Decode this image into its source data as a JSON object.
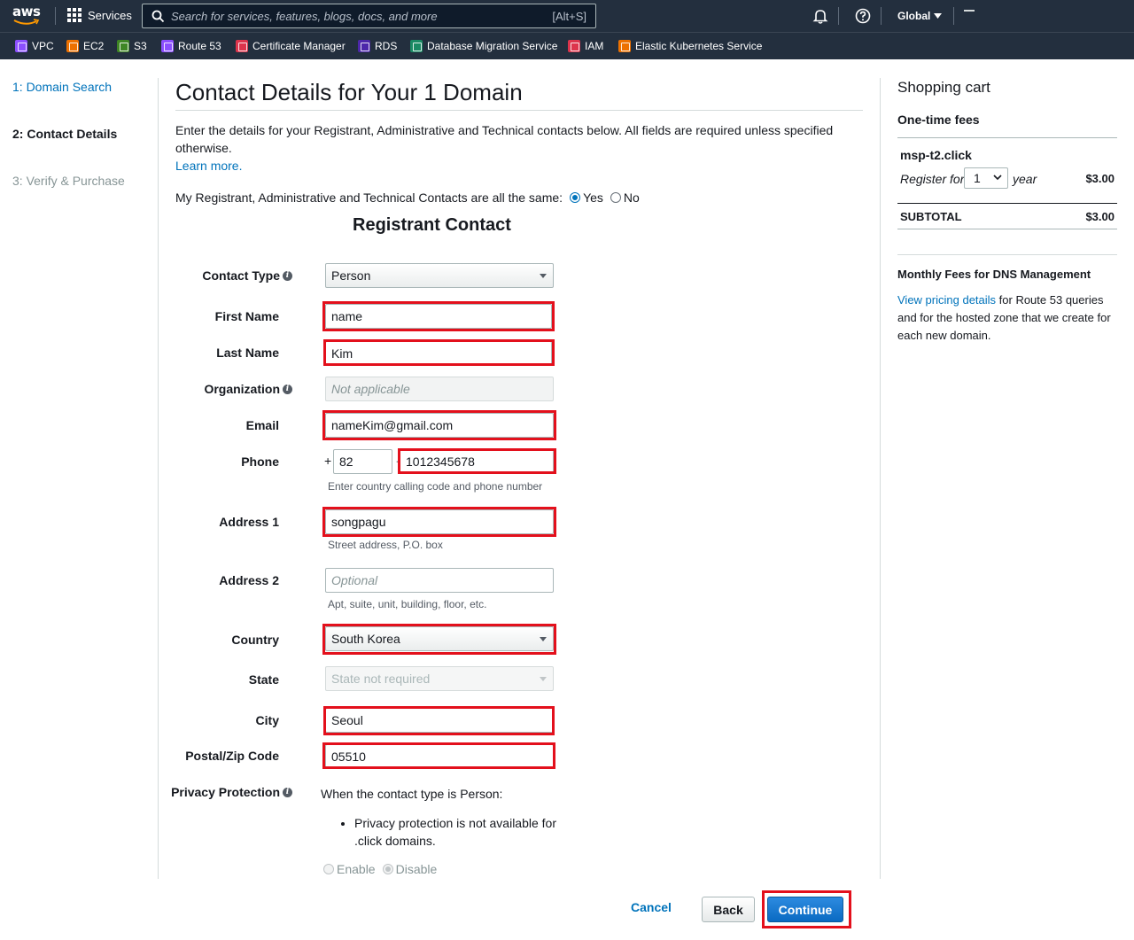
{
  "nav": {
    "logo_text": "aws",
    "services_label": "Services",
    "search_placeholder": "Search for services, features, blogs, docs, and more",
    "search_shortcut": "[Alt+S]",
    "region_label": "Global"
  },
  "favorites": [
    {
      "label": "VPC",
      "color": "#8c4fff"
    },
    {
      "label": "EC2",
      "color": "#ed7100"
    },
    {
      "label": "S3",
      "color": "#3f8624"
    },
    {
      "label": "Route 53",
      "color": "#8c4fff"
    },
    {
      "label": "Certificate Manager",
      "color": "#dd344c"
    },
    {
      "label": "RDS",
      "color": "#4d27aa"
    },
    {
      "label": "Database Migration Service",
      "color": "#1b8a64"
    },
    {
      "label": "IAM",
      "color": "#dd344c"
    },
    {
      "label": "Elastic Kubernetes Service",
      "color": "#ed7100"
    }
  ],
  "steps": [
    {
      "label": "1: Domain Search",
      "state": "link"
    },
    {
      "label": "2: Contact Details",
      "state": "active"
    },
    {
      "label": "3: Verify & Purchase",
      "state": "inactive"
    }
  ],
  "main": {
    "title": "Contact Details for Your 1 Domain",
    "intro": "Enter the details for your Registrant, Administrative and Technical contacts below. All fields are required unless specified otherwise.",
    "learn_more": "Learn more.",
    "same_contacts_question": "My Registrant, Administrative and Technical Contacts are all the same:",
    "yes_label": "Yes",
    "no_label": "No",
    "section_title": "Registrant Contact"
  },
  "form": {
    "contact_type": {
      "label": "Contact Type",
      "value": "Person"
    },
    "first_name": {
      "label": "First Name",
      "value": "name"
    },
    "last_name": {
      "label": "Last Name",
      "value": "Kim"
    },
    "organization": {
      "label": "Organization",
      "placeholder": "Not applicable"
    },
    "email": {
      "label": "Email",
      "value": "nameKim@gmail.com"
    },
    "phone": {
      "label": "Phone",
      "plus": "+",
      "code": "82",
      "number": "1012345678",
      "help": "Enter country calling code and phone number"
    },
    "address1": {
      "label": "Address 1",
      "value": "songpagu",
      "help": "Street address, P.O. box"
    },
    "address2": {
      "label": "Address 2",
      "placeholder": "Optional",
      "help": "Apt, suite, unit, building, floor, etc."
    },
    "country": {
      "label": "Country",
      "value": "South Korea"
    },
    "state": {
      "label": "State",
      "value": "State not required"
    },
    "city": {
      "label": "City",
      "value": "Seoul"
    },
    "postal": {
      "label": "Postal/Zip Code",
      "value": "05510"
    },
    "privacy": {
      "label": "Privacy Protection",
      "intro": "When the contact type is Person:",
      "bullet": "Privacy protection is not available for .click domains.",
      "enable_label": "Enable",
      "disable_label": "Disable"
    }
  },
  "buttons": {
    "cancel": "Cancel",
    "back": "Back",
    "continue": "Continue"
  },
  "cart": {
    "title": "Shopping cart",
    "one_time_fees": "One-time fees",
    "domain": "msp-t2.click",
    "register_for": "Register for",
    "years": "1",
    "year_label": "year",
    "price": "$3.00",
    "subtotal_label": "SUBTOTAL",
    "subtotal": "$3.00",
    "dns_title": "Monthly Fees for DNS Management",
    "dns_link": "View pricing details",
    "dns_text": " for Route 53 queries and for the hosted zone that we create for each new domain."
  },
  "highlight_color": "#e3101c",
  "accent_color": "#0073bb"
}
